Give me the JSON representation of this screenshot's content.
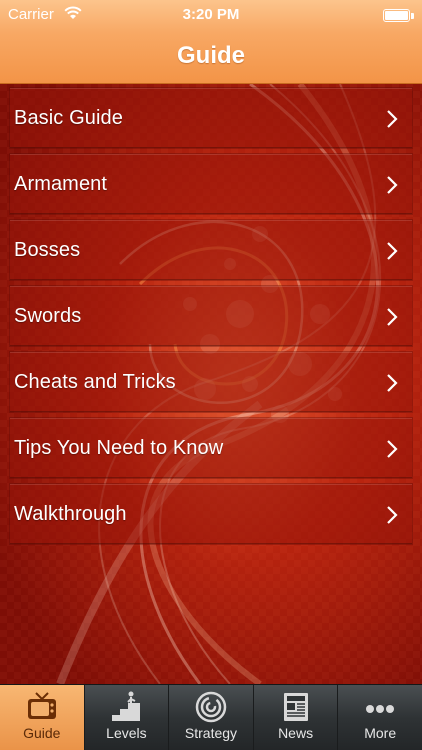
{
  "status_bar": {
    "carrier": "Carrier",
    "time": "3:20 PM",
    "wifi_icon": "wifi-icon",
    "battery_icon": "battery-icon"
  },
  "nav": {
    "title": "Guide"
  },
  "list": {
    "items": [
      {
        "label": "Basic Guide",
        "icon": "chevron-right-icon"
      },
      {
        "label": "Armament",
        "icon": "chevron-right-icon"
      },
      {
        "label": "Bosses",
        "icon": "chevron-right-icon"
      },
      {
        "label": "Swords",
        "icon": "chevron-right-icon"
      },
      {
        "label": "Cheats and Tricks",
        "icon": "chevron-right-icon"
      },
      {
        "label": "Tips You Need to Know",
        "icon": "chevron-right-icon"
      },
      {
        "label": "Walkthrough",
        "icon": "chevron-right-icon"
      }
    ]
  },
  "tabbar": {
    "selected": "Guide",
    "tabs": [
      {
        "label": "Guide",
        "icon": "tv-icon"
      },
      {
        "label": "Levels",
        "icon": "climber-icon"
      },
      {
        "label": "Strategy",
        "icon": "maze-icon"
      },
      {
        "label": "News",
        "icon": "newspaper-icon"
      },
      {
        "label": "More",
        "icon": "more-dots-icon"
      }
    ]
  },
  "colors": {
    "nav_orange": "#f39447",
    "background_red": "#b9240f",
    "tab_active": "#ea9348",
    "tab_dark": "#2f3335"
  }
}
